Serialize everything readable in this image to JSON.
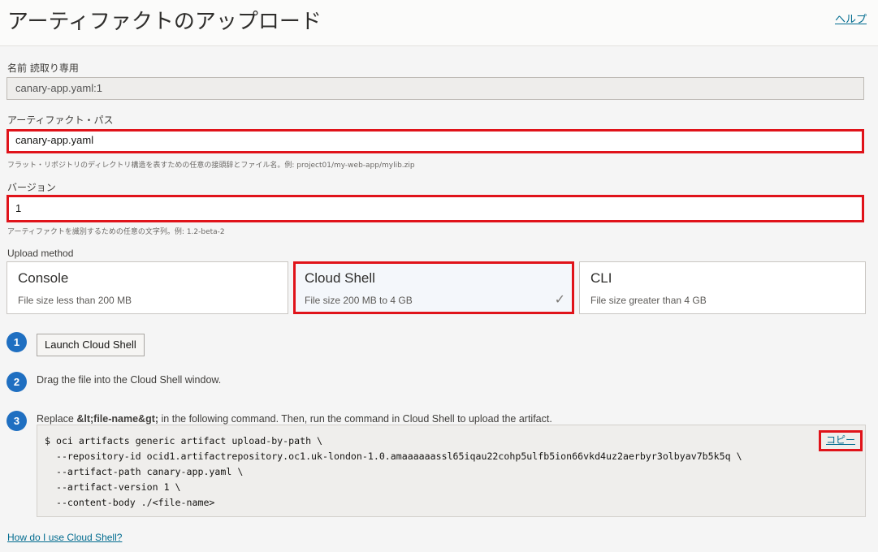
{
  "header": {
    "title": "アーティファクトのアップロード",
    "help_label": "ヘルプ"
  },
  "name_field": {
    "label": "名前 読取り専用",
    "value": "canary-app.yaml:1"
  },
  "path_field": {
    "label": "アーティファクト・パス",
    "value": "canary-app.yaml",
    "hint": "フラット・リポジトリのディレクトリ構造を表すための任意の接頭辞とファイル名。例: project01/my-web-app/mylib.zip"
  },
  "version_field": {
    "label": "バージョン",
    "value": "1",
    "hint": "アーティファクトを識別するための任意の文字列。例: 1.2-beta-2"
  },
  "upload_method": {
    "label": "Upload method",
    "options": [
      {
        "title": "Console",
        "subtitle": "File size less than 200 MB"
      },
      {
        "title": "Cloud Shell",
        "subtitle": "File size 200 MB to 4 GB",
        "selected": true
      },
      {
        "title": "CLI",
        "subtitle": "File size greater than 4 GB"
      }
    ]
  },
  "steps": [
    {
      "number": "1",
      "button_label": "Launch Cloud Shell"
    },
    {
      "number": "2",
      "text": "Drag the file into the Cloud Shell window."
    },
    {
      "number": "3",
      "text_pre": "Replace ",
      "text_bold": "&lt;file-name&gt;",
      "text_post": " in the following command. Then, run the command in Cloud Shell to upload the artifact."
    }
  ],
  "command": {
    "lines": [
      "$ oci artifacts generic artifact upload-by-path \\",
      "  --repository-id ocid1.artifactrepository.oc1.uk-london-1.0.amaaaaaassl65iqau22cohp5ulfb5ion66vkd4uz2aerbyr3olbyav7b5k5q \\",
      "  --artifact-path canary-app.yaml \\",
      "  --artifact-version 1 \\",
      "  --content-body ./<file-name>"
    ],
    "copy_label": "コピー"
  },
  "footer": {
    "help_link": "How do I use Cloud Shell?"
  },
  "colors": {
    "highlight": "#e0131a",
    "accent": "#1f6fc1",
    "link": "#006b8f"
  }
}
